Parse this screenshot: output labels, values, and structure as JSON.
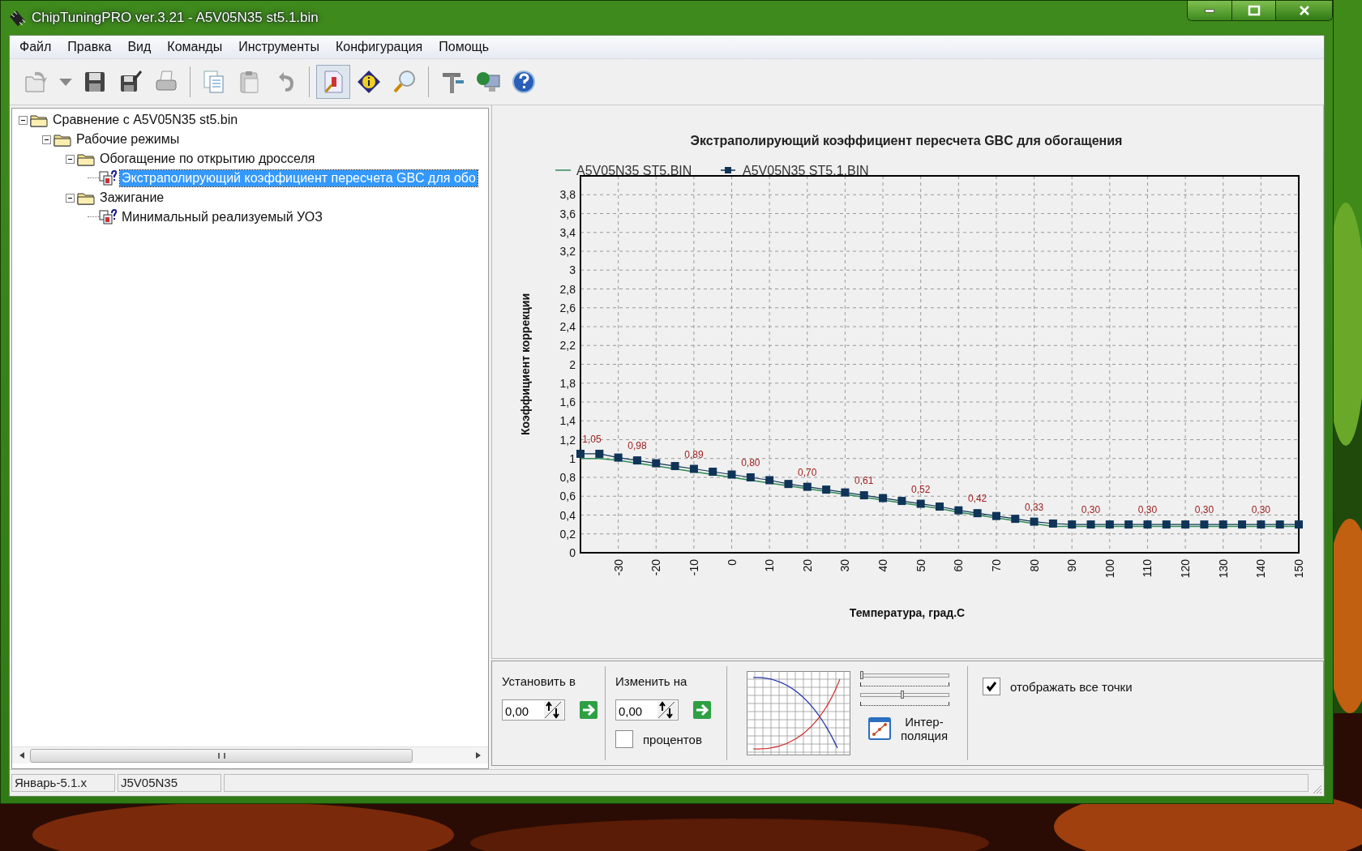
{
  "window": {
    "title": "ChipTuningPRO ver.3.21 - A5V05N35 st5.1.bin"
  },
  "menu": [
    "Файл",
    "Правка",
    "Вид",
    "Команды",
    "Инструменты",
    "Конфигурация",
    "Помощь"
  ],
  "toolbar": [
    [
      {
        "pressed": false
      },
      {
        "pressed": false
      },
      {
        "pressed": false
      },
      {
        "pressed": false
      },
      {
        "pressed": false
      }
    ],
    [
      {
        "pressed": false
      },
      {
        "pressed": false
      },
      {
        "pressed": false
      }
    ],
    [
      {
        "pressed": true
      },
      {
        "pressed": false
      },
      {
        "pressed": false
      }
    ],
    [
      {
        "pressed": false
      },
      {
        "pressed": false
      },
      {
        "pressed": false
      }
    ]
  ],
  "tree": [
    {
      "label": "Сравнение с A5V05N35 st5.bin",
      "kind": "folder",
      "expanded": true,
      "selected": false,
      "children": [
        {
          "label": "Рабочие режимы",
          "kind": "folder",
          "expanded": true,
          "selected": false,
          "children": [
            {
              "label": "Обогащение по открытию дросселя",
              "kind": "folder",
              "expanded": true,
              "selected": false,
              "children": [
                {
                  "label": "Экстраполирующий коэффициент пересчета GBC для обо",
                  "kind": "table",
                  "selected": true
                }
              ]
            },
            {
              "label": "Зажигание",
              "kind": "folder",
              "expanded": true,
              "selected": false,
              "children": [
                {
                  "label": "Минимальный реализуемый УОЗ",
                  "kind": "table",
                  "selected": false
                }
              ]
            }
          ]
        }
      ]
    }
  ],
  "chart": {
    "chart_data": {
      "type": "line",
      "title": "Экстраполирующий коэффициент пересчета GBC для обогащения",
      "xlabel": "Температура, град.С",
      "ylabel": "Коэффициент коррекции",
      "x": [
        -40,
        -35,
        -30,
        -25,
        -20,
        -15,
        -10,
        -5,
        0,
        5,
        10,
        15,
        20,
        25,
        30,
        35,
        40,
        45,
        50,
        55,
        60,
        65,
        70,
        75,
        80,
        85,
        90,
        95,
        100,
        105,
        110,
        115,
        120,
        125,
        130,
        135,
        140,
        145,
        150
      ],
      "series": [
        {
          "name": "A5V05N35 ST5.BIN",
          "color": "#2e8b57",
          "values": [
            1.0,
            1.0,
            0.98,
            0.95,
            0.92,
            0.89,
            0.86,
            0.83,
            0.8,
            0.77,
            0.74,
            0.71,
            0.68,
            0.65,
            0.62,
            0.59,
            0.56,
            0.53,
            0.5,
            0.47,
            0.43,
            0.4,
            0.37,
            0.34,
            0.31,
            0.28,
            0.28,
            0.28,
            0.28,
            0.28,
            0.28,
            0.28,
            0.28,
            0.28,
            0.28,
            0.28,
            0.28,
            0.28,
            0.28
          ]
        },
        {
          "name": "A5V05N35 ST5.1.BIN",
          "color": "#0f3457",
          "marker": "square",
          "values": [
            1.05,
            1.05,
            1.01,
            0.98,
            0.95,
            0.92,
            0.89,
            0.86,
            0.83,
            0.8,
            0.77,
            0.73,
            0.7,
            0.67,
            0.64,
            0.61,
            0.58,
            0.55,
            0.52,
            0.49,
            0.45,
            0.42,
            0.39,
            0.36,
            0.33,
            0.31,
            0.3,
            0.3,
            0.3,
            0.3,
            0.3,
            0.3,
            0.3,
            0.3,
            0.3,
            0.3,
            0.3,
            0.3,
            0.3
          ],
          "value_labels": [
            "1,05",
            null,
            null,
            "0,98",
            null,
            null,
            "0,89",
            null,
            null,
            "0,80",
            null,
            null,
            "0,70",
            null,
            null,
            "0,61",
            null,
            null,
            "0,52",
            null,
            null,
            "0,42",
            null,
            null,
            "0,33",
            null,
            null,
            "0,30",
            null,
            null,
            "0,30",
            null,
            null,
            "0,30",
            null,
            null,
            "0,30",
            null,
            null
          ]
        }
      ],
      "xlim": [
        -40,
        150
      ],
      "ylim": [
        0,
        4
      ],
      "grid": true,
      "legend": true,
      "xticks": [
        -30,
        -20,
        -10,
        0,
        10,
        20,
        30,
        40,
        50,
        60,
        70,
        80,
        90,
        100,
        110,
        120,
        130,
        140,
        150
      ],
      "yticks": [
        {
          "value": 0,
          "label": "0"
        },
        {
          "value": 0.2,
          "label": "0,2"
        },
        {
          "value": 0.4,
          "label": "0,4"
        },
        {
          "value": 0.6,
          "label": "0,6"
        },
        {
          "value": 0.8,
          "label": "0,8"
        },
        {
          "value": 1,
          "label": "1"
        },
        {
          "value": 1.2,
          "label": "1,2"
        },
        {
          "value": 1.4,
          "label": "1,4"
        },
        {
          "value": 1.6,
          "label": "1,6"
        },
        {
          "value": 1.8,
          "label": "1,8"
        },
        {
          "value": 2,
          "label": "2"
        },
        {
          "value": 2.2,
          "label": "2,2"
        },
        {
          "value": 2.4,
          "label": "2,4"
        },
        {
          "value": 2.6,
          "label": "2,6"
        },
        {
          "value": 2.8,
          "label": "2,8"
        },
        {
          "value": 3,
          "label": "3"
        },
        {
          "value": 3.2,
          "label": "3,2"
        },
        {
          "value": 3.4,
          "label": "3,4"
        },
        {
          "value": 3.6,
          "label": "3,6"
        },
        {
          "value": 3.8,
          "label": "3,8"
        }
      ]
    }
  },
  "controls": {
    "set_to": {
      "label": "Установить в",
      "value": "0,00"
    },
    "change_by": {
      "label": "Изменить на",
      "value": "0,00"
    },
    "percent": {
      "label": "процентов",
      "checked": false
    },
    "sliders": [
      {
        "level": 0.0
      },
      {
        "level": 0.45
      }
    ],
    "interpolation": {
      "label": "Интер-поляция"
    },
    "show_all_points": {
      "label": "отображать все точки",
      "checked": true
    }
  },
  "status_bar": [
    "Январь-5.1.x",
    "J5V05N35"
  ]
}
